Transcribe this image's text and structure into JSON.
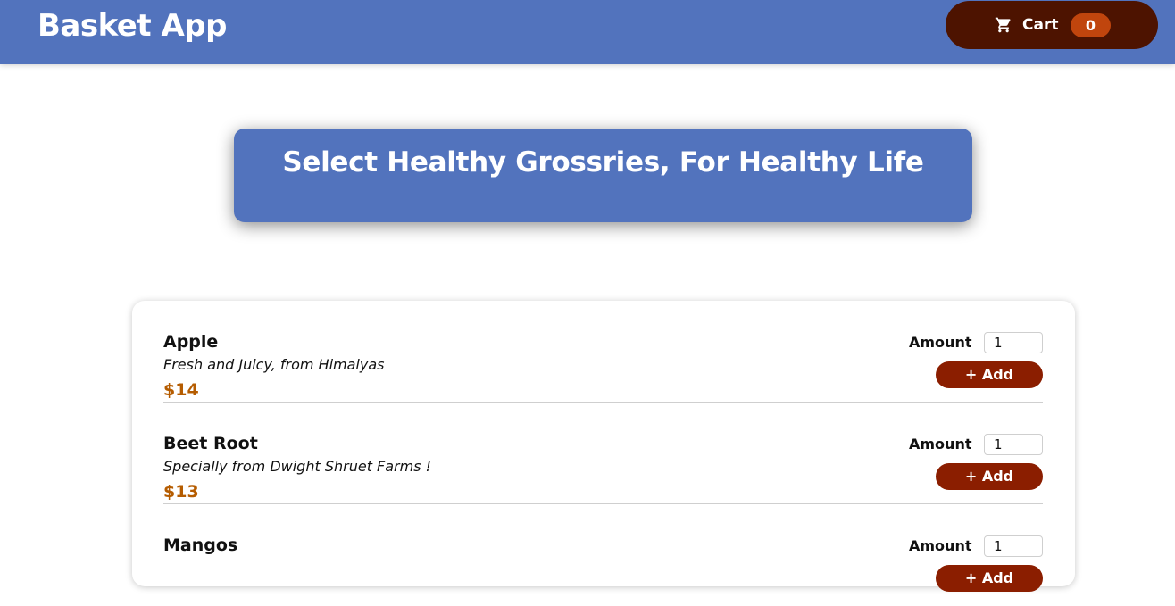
{
  "header": {
    "app_title": "Basket App",
    "cart_label": "Cart",
    "cart_count": "0",
    "cart_icon": "shopping-cart-icon"
  },
  "banner": {
    "title": "Select Healthy Grossries, For Healthy Life"
  },
  "products": [
    {
      "name": "Apple",
      "description": "Fresh and Juicy, from Himalyas",
      "price": "$14",
      "amount_label": "Amount",
      "amount_value": "1",
      "add_label": "+ Add"
    },
    {
      "name": "Beet Root",
      "description": "Specially from Dwight Shruet Farms !",
      "price": "$13",
      "amount_label": "Amount",
      "amount_value": "1",
      "add_label": "+ Add"
    },
    {
      "name": "Mangos",
      "description": "",
      "price": "",
      "amount_label": "Amount",
      "amount_value": "1",
      "add_label": "+ Add"
    }
  ],
  "colors": {
    "header_bg": "#5273bd",
    "cart_bg": "#4d1300",
    "cart_badge": "#c0450d",
    "add_button": "#8b1e00",
    "price": "#b55c00"
  }
}
